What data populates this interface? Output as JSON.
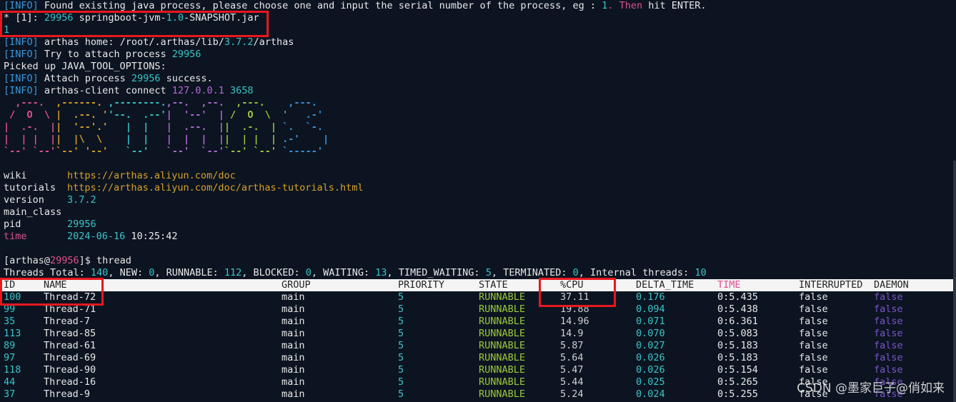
{
  "lines": {
    "l0_tag": "[INFO]",
    "l0_text": " Found existing java process, please choose one and input the serial number of the process, eg : ",
    "l0_one": "1",
    "l0_then": ". Then",
    "l0_rest": " hit ENTER.",
    "l1_star": "* [1]: ",
    "l1_pid": "29956",
    "l1_jar_a": " springboot-jvm-",
    "l1_jar_ver": "1.0",
    "l1_jar_b": "-SNAPSHOT.jar",
    "l2": "1",
    "l3_tag": "[INFO]",
    "l3_a": " arthas home: /root/.arthas/lib/",
    "l3_ver": "3.7.2",
    "l3_b": "/arthas",
    "l4_tag": "[INFO]",
    "l4_a": " Try to attach process ",
    "l4_pid": "29956",
    "l5": "Picked up JAVA_TOOL_OPTIONS:",
    "l6_tag": "[INFO]",
    "l6_a": " Attach process ",
    "l6_pid": "29956",
    "l6_b": " success.",
    "l7_tag": "[INFO]",
    "l7_a": " arthas-client connect ",
    "l7_ip": "127.0.0.1",
    "l7_port": "3658"
  },
  "logo": {
    "rows": [
      [
        "  ,---.  ",
        ",------. ",
        ",--------.",
        ",--.  ,--.",
        "  ,---.  ",
        "  ,---.   "
      ],
      [
        " /  O  \\ ",
        "|  .--. '",
        "'--.  .--'",
        "|  '--'  |",
        " /  O  \\ ",
        " '   .-'  "
      ],
      [
        "|  .-.  |",
        "|  '--'.'",
        "   |  |   ",
        "|  .--.  |",
        "|  .-.  |",
        " `.  `-.  "
      ],
      [
        "|  | |  |",
        "|  |\\  \\ ",
        "   |  |   ",
        "|  |  |  |",
        "|  | |  |",
        " .-'    | "
      ],
      [
        "`--' `--'",
        "`--' '--'",
        "   `--'   ",
        "`--'  `--'",
        "`--' `--'",
        " `-----'  "
      ]
    ],
    "colors": [
      "#e0508c",
      "#d6a02a",
      "#3ac5c9",
      "#b36ad6",
      "#9ac93a",
      "#3a96dd"
    ]
  },
  "info": {
    "wiki_key": "wiki",
    "wiki_val": "https://arthas.aliyun.com/doc",
    "tutorials_key": "tutorials",
    "tutorials_val": "https://arthas.aliyun.com/doc/arthas-tutorials.html",
    "version_key": "version",
    "version_val": "3.7.2",
    "main_class_key": "main_class",
    "pid_key": "pid",
    "pid_val": "29956",
    "time_key": "time",
    "time_date": "2024-06-16",
    "time_clock": "10:25:42"
  },
  "prompt": {
    "a": "[arthas@",
    "pid": "29956",
    "b": "]$ thread"
  },
  "summary": {
    "a": "Threads Total: ",
    "total": "140",
    "b": ", NEW: ",
    "new": "0",
    "c": ", RUNNABLE: ",
    "runnable": "112",
    "d": ", BLOCKED: ",
    "blocked": "0",
    "e": ", WAITING: ",
    "waiting": "13",
    "f": ", TIMED_WAITING: ",
    "timed": "5",
    "g": ", TERMINATED: ",
    "term": "0",
    "h": ", Internal threads: ",
    "internal": "10"
  },
  "table": {
    "headers": [
      "ID",
      "NAME",
      "GROUP",
      "PRIORITY",
      "STATE",
      "%CPU",
      "DELTA_TIME",
      "TIME",
      "INTERRUPTED",
      "DAEMON"
    ],
    "rows": [
      [
        "100",
        "Thread-72",
        "main",
        "5",
        "RUNNABLE",
        "37.11",
        "0.176",
        "0:5.435",
        "false",
        "false"
      ],
      [
        "99",
        "Thread-71",
        "main",
        "5",
        "RUNNABLE",
        "19.88",
        "0.094",
        "0:5.438",
        "false",
        "false"
      ],
      [
        "35",
        "Thread-7",
        "main",
        "5",
        "RUNNABLE",
        "14.96",
        "0.071",
        "0:6.361",
        "false",
        "false"
      ],
      [
        "113",
        "Thread-85",
        "main",
        "5",
        "RUNNABLE",
        "14.9",
        "0.070",
        "0:5.083",
        "false",
        "false"
      ],
      [
        "89",
        "Thread-61",
        "main",
        "5",
        "RUNNABLE",
        "5.87",
        "0.027",
        "0:5.183",
        "false",
        "false"
      ],
      [
        "97",
        "Thread-69",
        "main",
        "5",
        "RUNNABLE",
        "5.64",
        "0.026",
        "0:5.183",
        "false",
        "false"
      ],
      [
        "118",
        "Thread-90",
        "main",
        "5",
        "RUNNABLE",
        "5.47",
        "0.026",
        "0:5.154",
        "false",
        "false"
      ],
      [
        "44",
        "Thread-16",
        "main",
        "5",
        "RUNNABLE",
        "5.44",
        "0.025",
        "0:5.265",
        "false",
        "false"
      ],
      [
        "37",
        "Thread-9",
        "main",
        "5",
        "RUNNABLE",
        "5.24",
        "0.024",
        "0:5.255",
        "false",
        "false"
      ]
    ]
  },
  "watermark": "CSDN @墨家巨子@俏如来"
}
